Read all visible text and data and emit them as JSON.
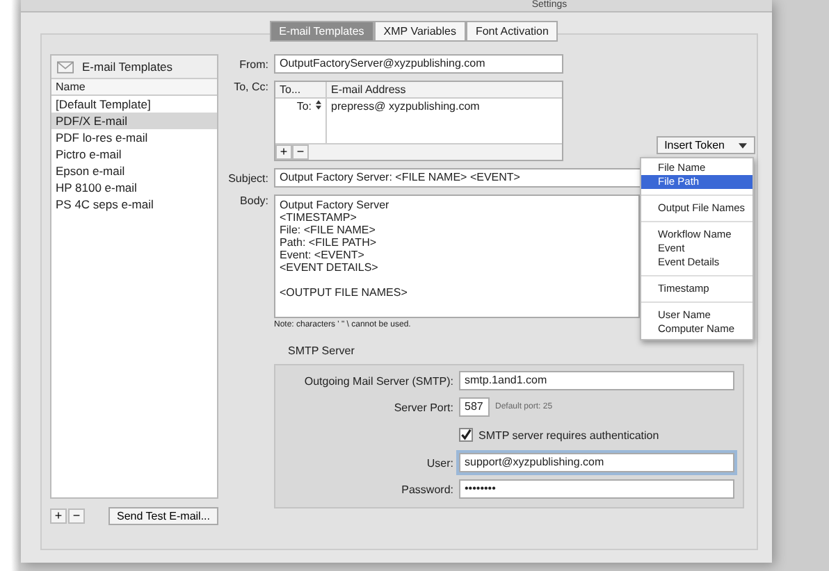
{
  "window": {
    "title": "Settings"
  },
  "tabs": [
    {
      "label": "E-mail Templates",
      "selected": true
    },
    {
      "label": "XMP Variables",
      "selected": false
    },
    {
      "label": "Font Activation",
      "selected": false
    }
  ],
  "templates": {
    "title": "E-mail Templates",
    "column": "Name",
    "items": [
      {
        "label": "[Default Template]",
        "selected": false
      },
      {
        "label": "PDF/X E-mail",
        "selected": true
      },
      {
        "label": "PDF lo-res e-mail",
        "selected": false
      },
      {
        "label": "Pictro e-mail",
        "selected": false
      },
      {
        "label": "Epson e-mail",
        "selected": false
      },
      {
        "label": "HP 8100 e-mail",
        "selected": false
      },
      {
        "label": "PS 4C seps e-mail",
        "selected": false
      }
    ],
    "add": "+",
    "remove": "−",
    "send_test": "Send Test E-mail..."
  },
  "from": {
    "label": "From:",
    "value": "OutputFactoryServer@xyzpublishing.com"
  },
  "recipients": {
    "label": "To, Cc:",
    "columns": [
      "To...",
      "E-mail Address"
    ],
    "rows": [
      {
        "type": "To:",
        "address": "prepress@ xyzpublishing.com"
      }
    ],
    "add": "+",
    "remove": "−"
  },
  "insert_token": {
    "label": "Insert Token",
    "menu": [
      [
        {
          "label": "File Name",
          "selected": false
        },
        {
          "label": "File Path",
          "selected": true
        }
      ],
      [
        {
          "label": "Output File Names",
          "selected": false
        }
      ],
      [
        {
          "label": "Workflow Name",
          "selected": false
        },
        {
          "label": "Event",
          "selected": false
        },
        {
          "label": "Event Details",
          "selected": false
        }
      ],
      [
        {
          "label": "Timestamp",
          "selected": false
        }
      ],
      [
        {
          "label": "User Name",
          "selected": false
        },
        {
          "label": "Computer Name",
          "selected": false
        }
      ]
    ]
  },
  "subject": {
    "label": "Subject:",
    "value": "Output Factory Server: <FILE NAME> <EVENT>"
  },
  "body": {
    "label": "Body:",
    "blocks": [
      [
        "Output Factory Server",
        "<TIMESTAMP>",
        "File: <FILE NAME>",
        "Path: <FILE PATH>",
        "Event: <EVENT>",
        "<EVENT DETAILS>"
      ],
      [
        "<OUTPUT FILE NAMES>"
      ]
    ],
    "note": "Note: characters ' \" \\ cannot be used."
  },
  "smtp": {
    "title": "SMTP Server",
    "server_label": "Outgoing Mail Server (SMTP):",
    "server": "smtp.1and1.com",
    "port_label": "Server Port:",
    "port": "587",
    "port_hint": "Default port: 25",
    "auth": {
      "label": "SMTP server requires authentication",
      "checked": true
    },
    "user_label": "User:",
    "user": "support@xyzpublishing.com",
    "password_label": "Password:",
    "password": "••••••••"
  }
}
